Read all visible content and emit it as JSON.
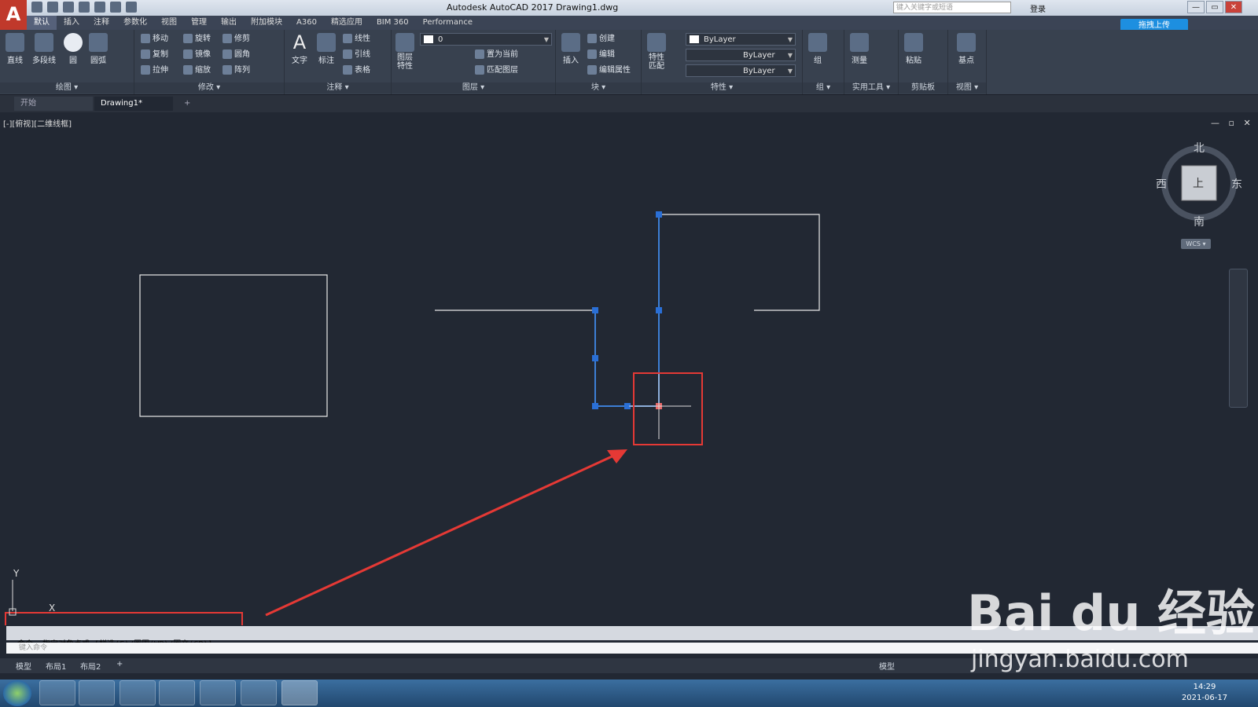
{
  "window": {
    "app_logo": "A",
    "title": "Autodesk AutoCAD 2017    Drawing1.dwg",
    "search_placeholder": "键入关键字或短语",
    "login": "登录",
    "controls": [
      "—",
      "▭",
      "✕"
    ]
  },
  "menu_tabs": [
    "默认",
    "插入",
    "注释",
    "参数化",
    "视图",
    "管理",
    "输出",
    "附加模块",
    "A360",
    "精选应用",
    "BIM 360",
    "Performance"
  ],
  "active_tab": "默认",
  "upload_button": "拖拽上传",
  "ribbon": {
    "draw": {
      "title": "绘图 ▾",
      "line": "直线",
      "polyline": "多段线",
      "circle": "圆",
      "arc": "圆弧"
    },
    "modify": {
      "title": "修改 ▾",
      "move": "移动",
      "rotate": "旋转",
      "trim": "修剪",
      "copy": "复制",
      "mirror": "镜像",
      "fillet": "圆角",
      "stretch": "拉伸",
      "scale": "缩放",
      "array": "阵列"
    },
    "annotation": {
      "title": "注释 ▾",
      "text": "文字",
      "dimension": "标注",
      "linear": "线性",
      "leader": "引线",
      "table": "表格"
    },
    "layers": {
      "title": "图层 ▾",
      "layer_props": "图层\n特性",
      "layer_value": "0",
      "set_current": "置为当前",
      "match_layer": "匹配图层"
    },
    "block": {
      "title": "块 ▾",
      "insert": "插入",
      "create": "创建",
      "edit": "编辑",
      "edit_attr": "编辑属性"
    },
    "properties": {
      "title": "特性 ▾",
      "match": "特性\n匹配",
      "color": "ByLayer",
      "linetype": "ByLayer",
      "lineweight": "ByLayer"
    },
    "groups": {
      "title": "组 ▾",
      "group": "组"
    },
    "utilities": {
      "title": "实用工具 ▾",
      "measure": "测量"
    },
    "clipboard": {
      "title": "剪贴板",
      "paste": "粘贴"
    },
    "view": {
      "title": "视图 ▾",
      "base": "基点"
    }
  },
  "doc_tabs": {
    "start": "开始",
    "drawing": "Drawing1*",
    "add": "+"
  },
  "viewport_label": "[-][俯视][二维线框]",
  "viewport_controls": "— ▫ ✕",
  "viewcube": {
    "north": "北",
    "south": "南",
    "east": "东",
    "west": "西",
    "top": "上",
    "wcs": "WCS ▾"
  },
  "ucs": {
    "y": "Y",
    "x": "X"
  },
  "command": {
    "history": "命令: 指定对角点或 [栏选(F)/圈围(WP)/圈交(CP)]:",
    "placeholder": "键入命令"
  },
  "layout_tabs": [
    "模型",
    "布局1",
    "布局2",
    "+"
  ],
  "status_bar": {
    "model": "模型"
  },
  "taskbar": {
    "time": "14:29",
    "date": "2021-06-17"
  },
  "watermark": {
    "brand": "Bai du 经验",
    "url": "jingyan.baidu.com"
  },
  "colors": {
    "accent": "#1d8fe0",
    "selection": "#3d7fd6",
    "annotation_red": "#e53935",
    "canvas": "#222833"
  }
}
